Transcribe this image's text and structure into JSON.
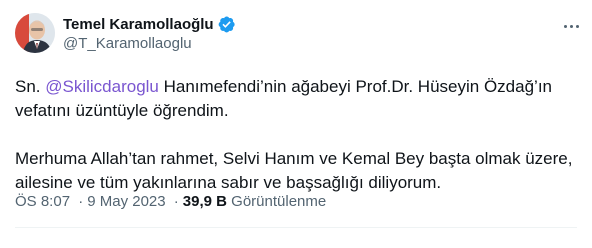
{
  "author": {
    "name": "Temel Karamollaoğlu",
    "handle": "@T_Karamollaoglu"
  },
  "tweet": {
    "line1_prefix": "Sn. ",
    "mention": "@Skilicdaroglu",
    "line1_suffix": " Hanımefendi’nin ağabeyi Prof.Dr. Hüseyin Özdağ’ın vefatını üzüntüyle öğrendim.",
    "paragraph2": "Merhuma Allah’tan rahmet, Selvi Hanım ve Kemal Bey başta olmak üzere, ailesine ve tüm yakınlarına sabır ve başsağlığı diliyorum."
  },
  "meta": {
    "time": "ÖS 8:07",
    "separator": "·",
    "date": "9 May 2023",
    "views_count": "39,9 B",
    "views_label": "Görüntülenme"
  },
  "colors": {
    "verified_badge": "#1d9bf0",
    "mention": "#7a56d0",
    "secondary_text": "#536471"
  },
  "icons": {
    "verified": "verified-badge-icon",
    "more": "more-options-icon"
  }
}
